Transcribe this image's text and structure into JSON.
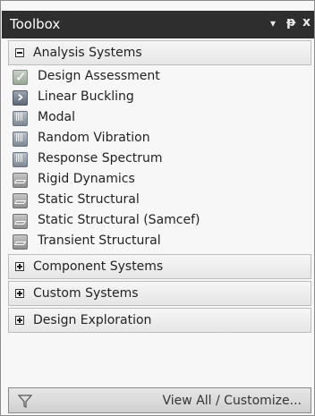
{
  "titlebar": {
    "title": "Toolbox",
    "dropdown_icon": "▾",
    "pin_icon": "ᵽ",
    "close_icon": "x"
  },
  "sections": {
    "analysis": {
      "label": "Analysis Systems",
      "expanded": true,
      "items": [
        {
          "label": "Design Assessment",
          "icon": "check-icon"
        },
        {
          "label": "Linear Buckling",
          "icon": "arrow-icon"
        },
        {
          "label": "Modal",
          "icon": "bars-icon"
        },
        {
          "label": "Random Vibration",
          "icon": "bars-icon"
        },
        {
          "label": "Response Spectrum",
          "icon": "bars-icon"
        },
        {
          "label": "Rigid Dynamics",
          "icon": "plate-icon"
        },
        {
          "label": "Static Structural",
          "icon": "plate-icon"
        },
        {
          "label": "Static Structural (Samcef)",
          "icon": "plate-icon"
        },
        {
          "label": "Transient Structural",
          "icon": "plate-icon"
        }
      ]
    },
    "component": {
      "label": "Component Systems",
      "expanded": false
    },
    "custom": {
      "label": "Custom Systems",
      "expanded": false
    },
    "exploration": {
      "label": "Design Exploration",
      "expanded": false
    }
  },
  "footer": {
    "label": "View All / Customize..."
  }
}
